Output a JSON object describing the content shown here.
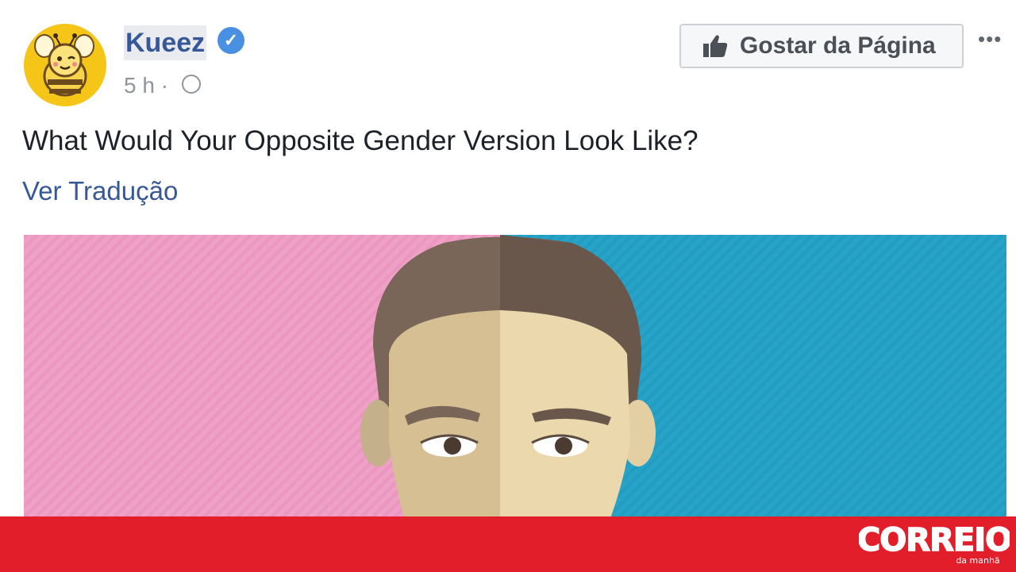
{
  "post": {
    "page_name": "Kueez",
    "time": "5 h ·",
    "text": "What Would Your Opposite Gender Version Look Like?",
    "translate_link": "Ver Tradução"
  },
  "header_actions": {
    "like_page_label": "Gostar da Página",
    "more_icon": "more-icon"
  },
  "icons": {
    "verified": "verified-check-icon",
    "globe": "globe-icon",
    "thumb": "thumb-up-icon"
  },
  "colors": {
    "link": "#365899",
    "pink_bg": "#eea0c6",
    "blue_bg": "#28a3c8",
    "brand_red": "#e31e2b"
  },
  "watermark": {
    "logo_text": "CORREIO",
    "logo_subtext": "da manhã"
  }
}
